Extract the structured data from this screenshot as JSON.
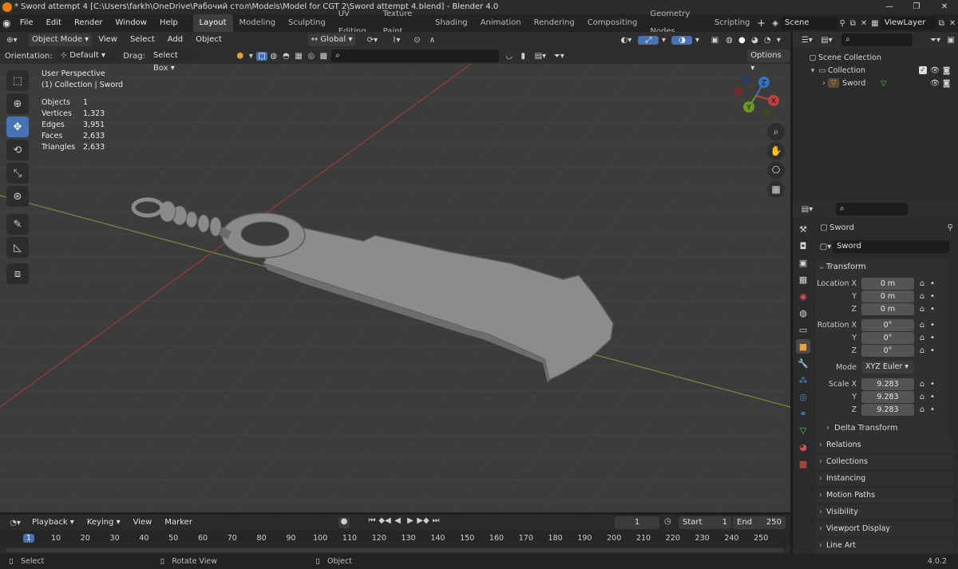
{
  "window": {
    "title": "* Sword attempt 4 [C:\\Users\\farkh\\OneDrive\\Рабочий стол\\Models\\Model for CGT 2\\Sword attempt 4.blend] - Blender 4.0"
  },
  "menu": {
    "items": [
      "File",
      "Edit",
      "Render",
      "Window",
      "Help"
    ],
    "workspaces": [
      "Layout",
      "Modeling",
      "Sculpting",
      "UV Editing",
      "Texture Paint",
      "Shading",
      "Animation",
      "Rendering",
      "Compositing",
      "Geometry Nodes",
      "Scripting"
    ],
    "scene": "Scene",
    "view_layer": "ViewLayer"
  },
  "viewport": {
    "mode": "Object Mode",
    "header_menu": [
      "View",
      "Select",
      "Add",
      "Object"
    ],
    "transform_orientation": "Global",
    "orientation_label": "Orientation:",
    "orientation_value": "Default",
    "drag_label": "Drag:",
    "drag_value": "Select Box",
    "options": "Options",
    "overlay": {
      "perspective": "User Perspective",
      "collection": "(1) Collection | Sword",
      "stats": [
        {
          "label": "Objects",
          "value": "1"
        },
        {
          "label": "Vertices",
          "value": "1,323"
        },
        {
          "label": "Edges",
          "value": "3,951"
        },
        {
          "label": "Faces",
          "value": "2,633"
        },
        {
          "label": "Triangles",
          "value": "2,633"
        }
      ]
    },
    "gizmo": {
      "x": "X",
      "y": "Y",
      "z": "Z"
    }
  },
  "outliner": {
    "root": "Scene Collection",
    "collection": "Collection",
    "object": "Sword"
  },
  "properties": {
    "object_name": "Sword",
    "data_name": "Sword",
    "transform_title": "Transform",
    "location_label": "Location X",
    "rotation_label": "Rotation X",
    "scale_label": "Scale X",
    "axis_y": "Y",
    "axis_z": "Z",
    "location": [
      "0 m",
      "0 m",
      "0 m"
    ],
    "rotation": [
      "0°",
      "0°",
      "0°"
    ],
    "mode_label": "Mode",
    "mode_value": "XYZ Euler",
    "scale": [
      "9.283",
      "9.283",
      "9.283"
    ],
    "delta": "Delta Transform",
    "panels": [
      "Relations",
      "Collections",
      "Instancing",
      "Motion Paths",
      "Visibility",
      "Viewport Display",
      "Line Art"
    ]
  },
  "timeline": {
    "menu": [
      "Playback",
      "Keying",
      "View",
      "Marker"
    ],
    "current_frame": "1",
    "start_label": "Start",
    "start": "1",
    "end_label": "End",
    "end": "250",
    "ticks": [
      "1",
      "10",
      "20",
      "30",
      "40",
      "50",
      "60",
      "70",
      "80",
      "90",
      "100",
      "110",
      "120",
      "130",
      "140",
      "150",
      "160",
      "170",
      "180",
      "190",
      "200",
      "210",
      "220",
      "230",
      "240",
      "250"
    ]
  },
  "status": {
    "select": "Select",
    "rotate": "Rotate View",
    "object": "Object",
    "version": "4.0.2"
  }
}
